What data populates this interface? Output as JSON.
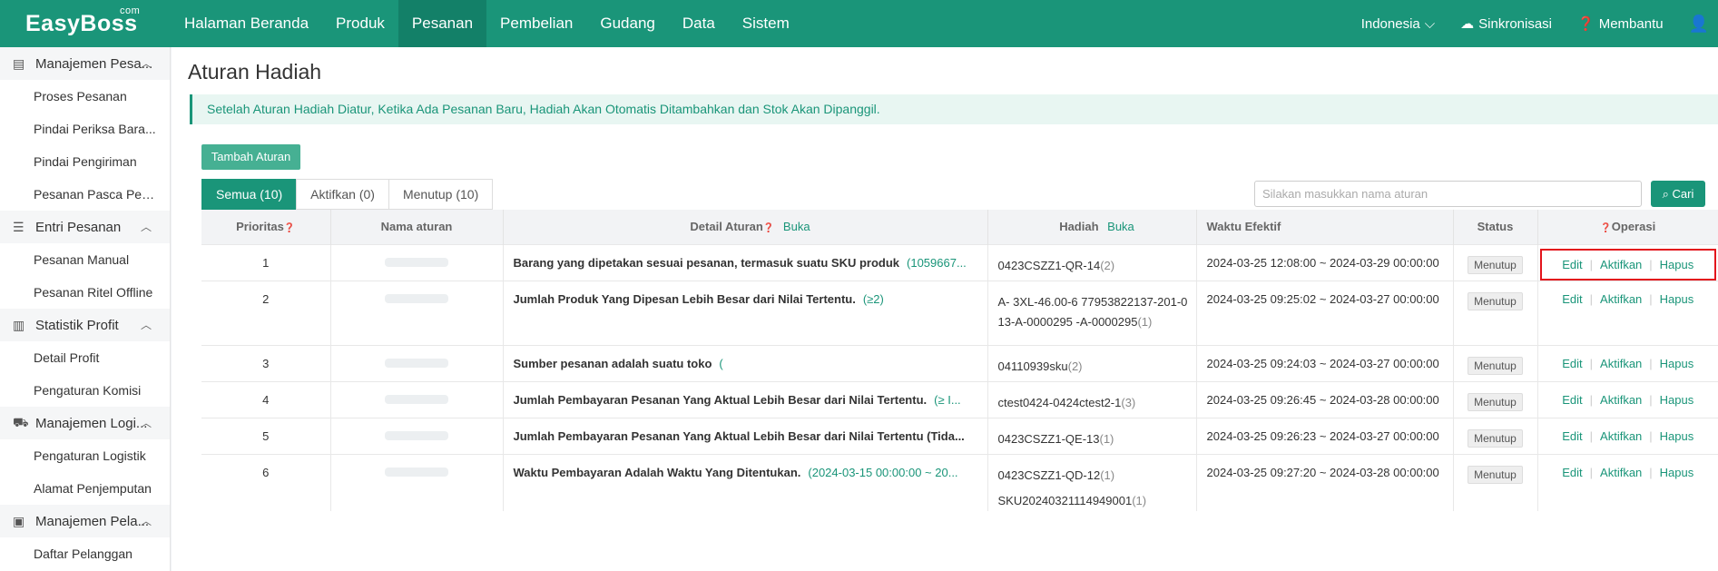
{
  "app": {
    "logo": "EasyBoss",
    "logo_sup": "com"
  },
  "nav": [
    "Halaman Beranda",
    "Produk",
    "Pesanan",
    "Pembelian",
    "Gudang",
    "Data",
    "Sistem"
  ],
  "top_right": {
    "language": "Indonesia",
    "sync": "Sinkronisasi",
    "help": "Membantu"
  },
  "sidebar": {
    "groups": [
      {
        "label": "Manajemen Pesa...",
        "icon": "clipboard-icon",
        "items": [
          "Proses Pesanan",
          "Pindai Periksa Bara...",
          "Pindai Pengiriman",
          "Pesanan Pasca Penj..."
        ]
      },
      {
        "label": "Entri Pesanan",
        "icon": "list-icon",
        "items": [
          "Pesanan Manual",
          "Pesanan Ritel Offline"
        ]
      },
      {
        "label": "Statistik Profit",
        "icon": "chart-icon",
        "items": [
          "Detail Profit",
          "Pengaturan Komisi"
        ]
      },
      {
        "label": "Manajemen Logi...",
        "icon": "truck-icon",
        "items": [
          "Pengaturan Logistik",
          "Alamat Penjemputan"
        ]
      },
      {
        "label": "Manajemen Pela...",
        "icon": "user-icon",
        "items": [
          "Daftar Pelanggan"
        ]
      }
    ]
  },
  "page": {
    "title": "Aturan Hadiah",
    "notice": "Setelah Aturan Hadiah Diatur, Ketika Ada Pesanan Baru, Hadiah Akan Otomatis Ditambahkan dan Stok Akan Dipanggil.",
    "add_button": "Tambah Aturan",
    "tabs": [
      "Semua (10)",
      "Aktifkan (0)",
      "Menutup (10)"
    ],
    "search_placeholder": "Silakan masukkan nama aturan",
    "search_button": "Cari"
  },
  "table": {
    "headers": {
      "priority": "Prioritas",
      "name": "Nama aturan",
      "detail": "Detail Aturan",
      "detail_link": "Buka",
      "gift": "Hadiah",
      "gift_link": "Buka",
      "time": "Waktu Efektif",
      "status": "Status",
      "ops": "Operasi"
    },
    "ops": {
      "edit": "Edit",
      "activate": "Aktifkan",
      "delete": "Hapus"
    },
    "rows": [
      {
        "priority": "1",
        "detail": "Barang yang dipetakan sesuai pesanan, termasuk suatu SKU produk",
        "detail_value": "(1059667...",
        "gifts": [
          {
            "name": "0423CSZZ1-QR-14",
            "count": "(2)"
          }
        ],
        "time": "2024-03-25 12:08:00 ~ 2024-03-29 00:00:00",
        "status": "Menutup"
      },
      {
        "priority": "2",
        "detail": "Jumlah Produk Yang Dipesan Lebih Besar dari Nilai Tertentu.",
        "detail_value": "(≥2)",
        "gifts": [
          {
            "name": "A-            3XL-46.00-6 77953822137-201-013-A-0000295 -A-0000295",
            "count": "(1)"
          }
        ],
        "time": "2024-03-25 09:25:02 ~ 2024-03-27 00:00:00",
        "status": "Menutup"
      },
      {
        "priority": "3",
        "detail": "Sumber pesanan adalah suatu toko",
        "detail_value": "(",
        "gifts": [
          {
            "name": "04110939sku",
            "count": "(2)"
          }
        ],
        "time": "2024-03-25 09:24:03 ~ 2024-03-27 00:00:00",
        "status": "Menutup"
      },
      {
        "priority": "4",
        "detail": "Jumlah Pembayaran Pesanan Yang Aktual Lebih Besar dari Nilai Tertentu.",
        "detail_value": "(≥ I...",
        "gifts": [
          {
            "name": "ctest0424-0424ctest2-1",
            "count": "(3)"
          }
        ],
        "time": "2024-03-25 09:26:45 ~ 2024-03-28 00:00:00",
        "status": "Menutup"
      },
      {
        "priority": "5",
        "detail": "Jumlah Pembayaran Pesanan Yang Aktual Lebih Besar dari Nilai Tertentu (Tida...",
        "detail_value": "",
        "gifts": [
          {
            "name": "0423CSZZ1-QE-13",
            "count": "(1)"
          }
        ],
        "time": "2024-03-25 09:26:23 ~ 2024-03-27 00:00:00",
        "status": "Menutup"
      },
      {
        "priority": "6",
        "detail": "Waktu Pembayaran Adalah Waktu Yang Ditentukan.",
        "detail_value": "(2024-03-15 00:00:00 ~ 20...",
        "gifts": [
          {
            "name": "0423CSZZ1-QD-12",
            "count": "(1)"
          },
          {
            "name": "SKU20240321114949001",
            "count": "(1)"
          }
        ],
        "time": "2024-03-25 09:27:20 ~ 2024-03-28 00:00:00",
        "status": "Menutup"
      }
    ]
  }
}
